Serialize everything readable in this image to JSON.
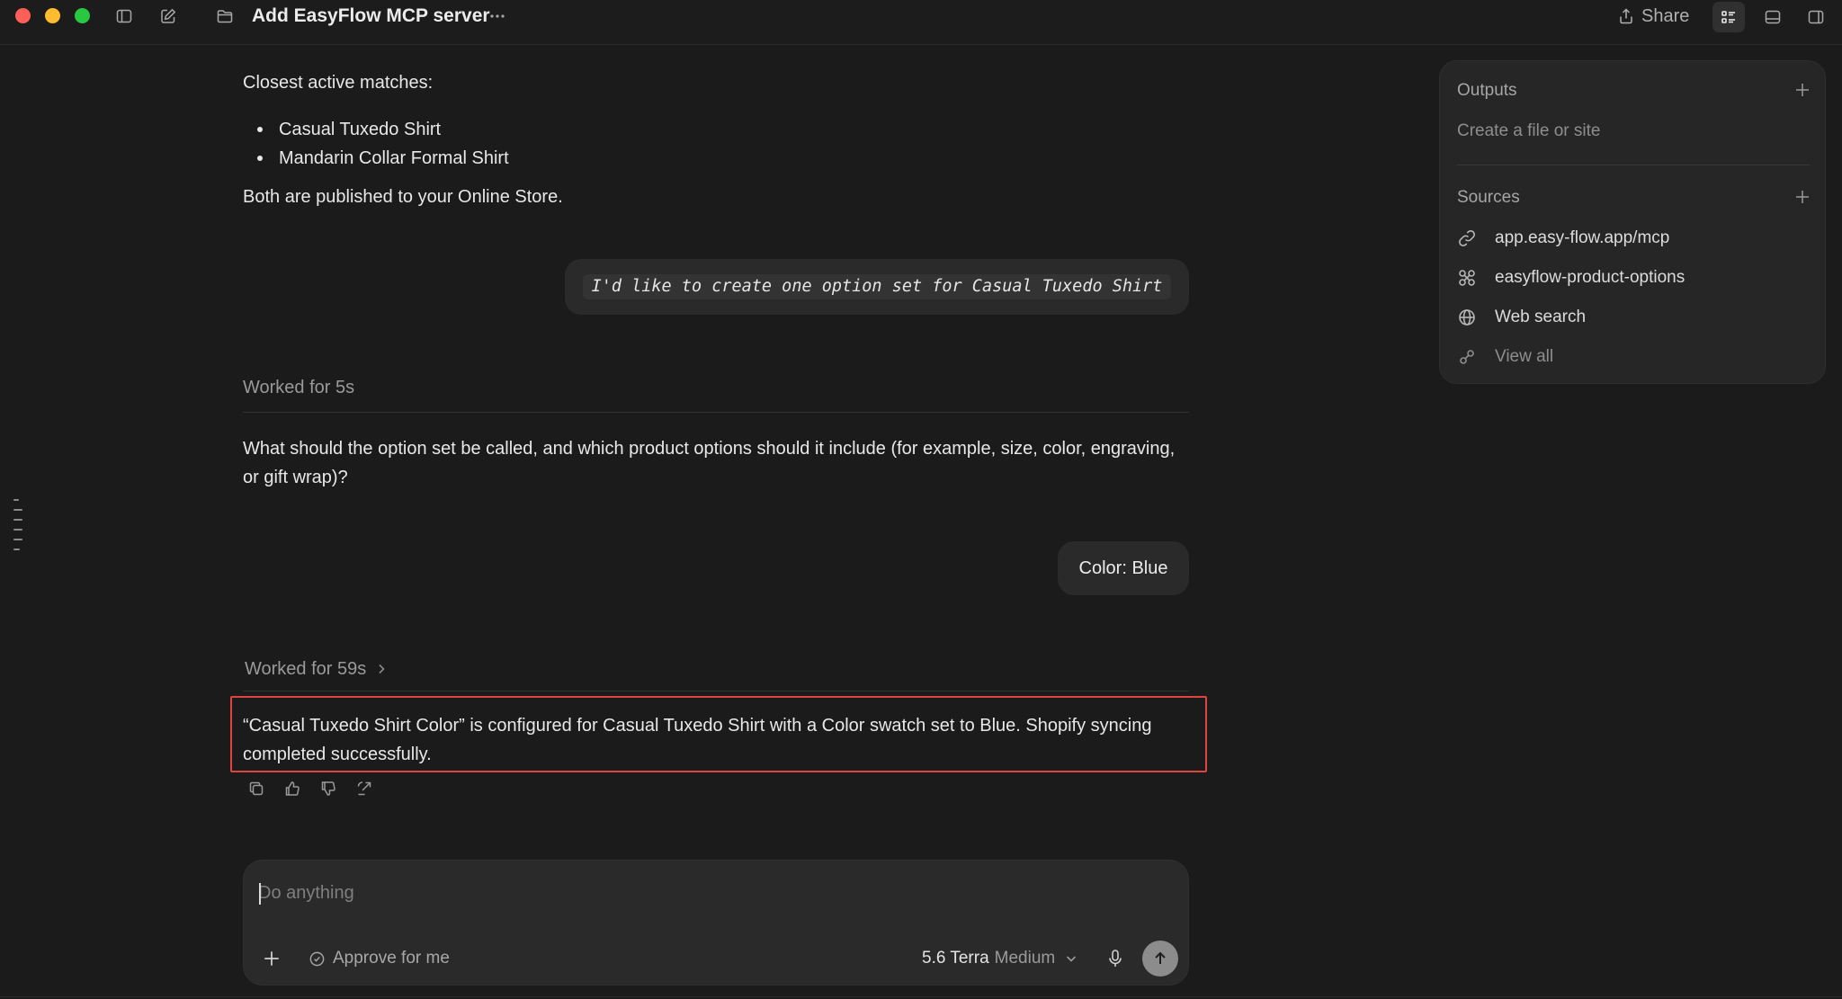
{
  "window": {
    "title": "Add EasyFlow MCP server",
    "share_label": "Share"
  },
  "conversation": {
    "closest_label": "Closest active matches:",
    "matches": [
      "Casual Tuxedo Shirt",
      "Mandarin Collar Formal Shirt"
    ],
    "published_text": "Both are published to your Online Store.",
    "user_message_1": "I'd like to create one option set for Casual Tuxedo Shirt",
    "worked_1": "Worked for 5s",
    "question_text": "What should the option set be called, and which product options should it include (for example, size, color, engraving, or gift wrap)?",
    "user_message_2": "Color: Blue",
    "worked_2": "Worked for 59s",
    "answer_text": "“Casual Tuxedo Shirt Color” is configured for Casual Tuxedo Shirt with a Color swatch set to Blue. Shopify syncing completed successfully."
  },
  "composer": {
    "placeholder": "Do anything",
    "approve_label": "Approve for me",
    "model_name": "5.6 Terra",
    "model_level": "Medium"
  },
  "panel": {
    "outputs_title": "Outputs",
    "outputs_placeholder": "Create a file or site",
    "sources_title": "Sources",
    "sources": [
      {
        "label": "app.easy-flow.app/mcp",
        "icon": "link-icon"
      },
      {
        "label": "easyflow-product-options",
        "icon": "command-icon"
      },
      {
        "label": "Web search",
        "icon": "globe-icon"
      },
      {
        "label": "View all",
        "icon": "sources-icon"
      }
    ]
  },
  "colors": {
    "background": "#1b1b1b",
    "bubble": "#2a2a2a",
    "highlight_border": "#e0443f"
  }
}
